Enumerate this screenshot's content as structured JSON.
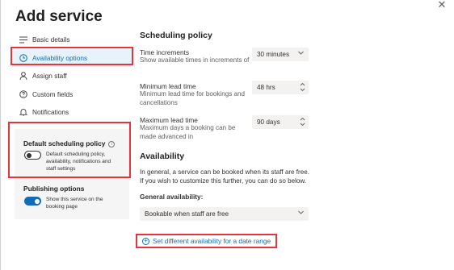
{
  "panel": {
    "title": "Add service",
    "close_glyph": "✕"
  },
  "nav": {
    "items": [
      {
        "label": "Basic details",
        "icon": "list-icon"
      },
      {
        "label": "Availability options",
        "icon": "clock-icon"
      },
      {
        "label": "Assign staff",
        "icon": "person-icon"
      },
      {
        "label": "Custom fields",
        "icon": "question-icon"
      },
      {
        "label": "Notifications",
        "icon": "bell-icon"
      }
    ],
    "active_index": 1
  },
  "default_policy": {
    "title": "Default scheduling policy",
    "info_glyph": "i",
    "toggle_on": false,
    "description": "Default scheduling policy, availability, notifications and staff settings"
  },
  "publishing": {
    "title": "Publishing options",
    "toggle_on": true,
    "description": "Show this service on the booking page"
  },
  "scheduling": {
    "heading": "Scheduling policy",
    "time_increments": {
      "label": "Time increments",
      "help": "Show available times in increments of",
      "value": "30 minutes"
    },
    "min_lead": {
      "label": "Minimum lead time",
      "help": "Minimum lead time for bookings and cancellations",
      "value": "48 hrs"
    },
    "max_lead": {
      "label": "Maximum lead time",
      "help": "Maximum days a booking can be made advanced in",
      "value": "90 days"
    }
  },
  "availability": {
    "heading": "Availability",
    "description": "In general, a service can be booked when its staff are free. If you wish to customize this further, you can do so below.",
    "general_label": "General availability:",
    "general_value": "Bookable when staff are free",
    "date_range_link": "Set different availability for a date range"
  },
  "colors": {
    "accent": "#0f6cbd",
    "highlight": "#e4343c"
  }
}
